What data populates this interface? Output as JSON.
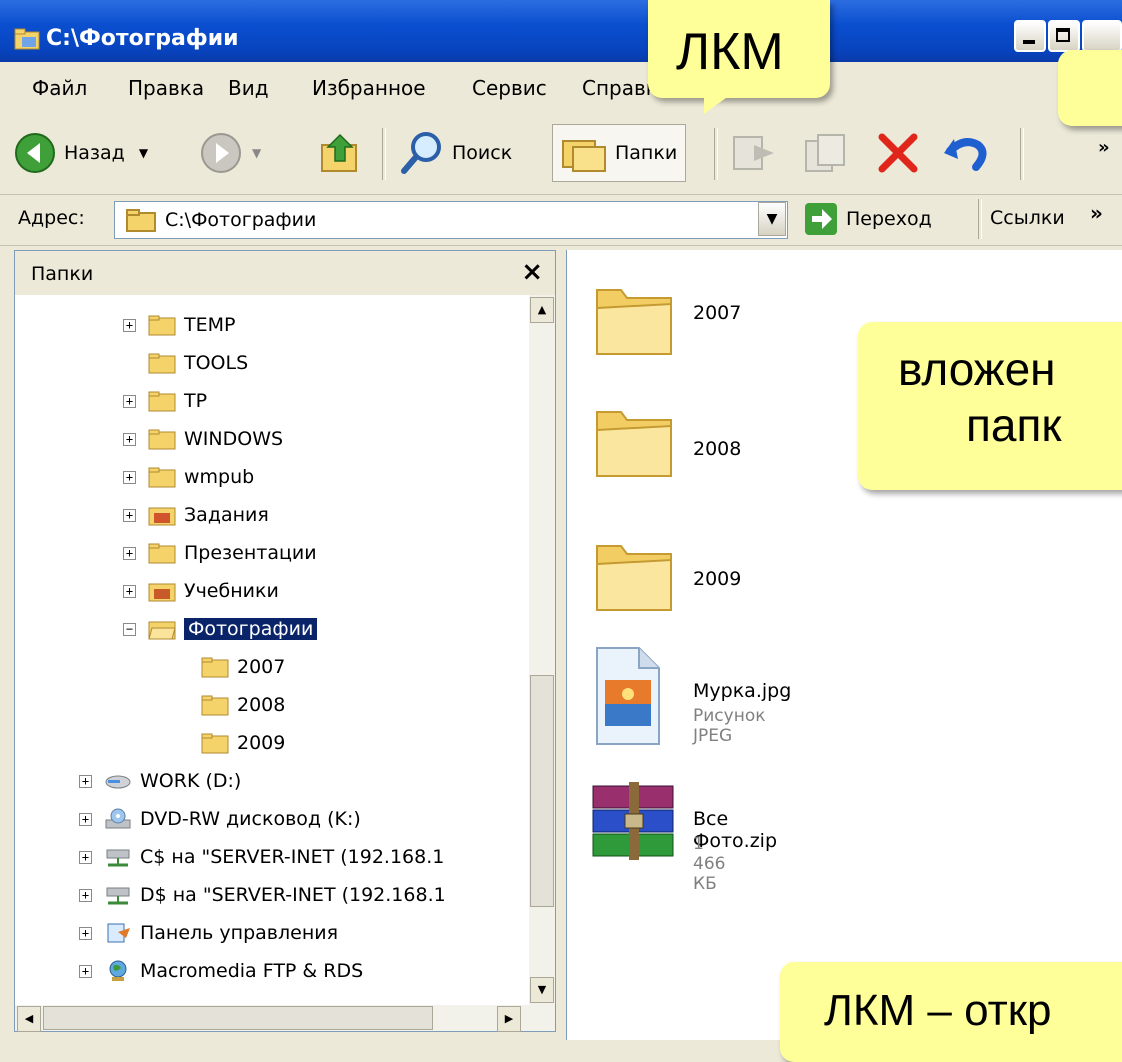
{
  "window": {
    "title": "C:\\Фотографии"
  },
  "menu": [
    "Файл",
    "Правка",
    "Вид",
    "Избранное",
    "Сервис",
    "Справка"
  ],
  "toolbar": {
    "back": "Назад",
    "search": "Поиск",
    "folders": "Папки"
  },
  "address": {
    "label": "Адрес:",
    "value": "C:\\Фотографии",
    "go": "Переход",
    "links": "Ссылки"
  },
  "left_pane": {
    "title": "Папки",
    "items": [
      {
        "label": "TEMP"
      },
      {
        "label": "TOOLS"
      },
      {
        "label": "TP"
      },
      {
        "label": "WINDOWS"
      },
      {
        "label": "wmpub"
      },
      {
        "label": "Задания"
      },
      {
        "label": "Презентации"
      },
      {
        "label": "Учебники"
      },
      {
        "label": "Фотографии"
      },
      {
        "label": "2007"
      },
      {
        "label": "2008"
      },
      {
        "label": "2009"
      },
      {
        "label": "WORK (D:)"
      },
      {
        "label": "DVD-RW дисковод (K:)"
      },
      {
        "label": "C$ на \"SERVER-INET (192.168.1"
      },
      {
        "label": "D$ на \"SERVER-INET (192.168.1"
      },
      {
        "label": "Панель управления"
      },
      {
        "label": "Macromedia FTP & RDS"
      }
    ]
  },
  "files": [
    {
      "name": "2007"
    },
    {
      "name": "2008"
    },
    {
      "name": "2009"
    },
    {
      "name": "Мурка.jpg",
      "type": "Рисунок JPEG"
    },
    {
      "name": "Все Фото.zip",
      "size": "1 466 КБ"
    }
  ],
  "callouts": {
    "lkm": "ЛКМ",
    "nested": "вложен",
    "nested2": "папк",
    "lkm_open": "ЛКМ – откр"
  }
}
